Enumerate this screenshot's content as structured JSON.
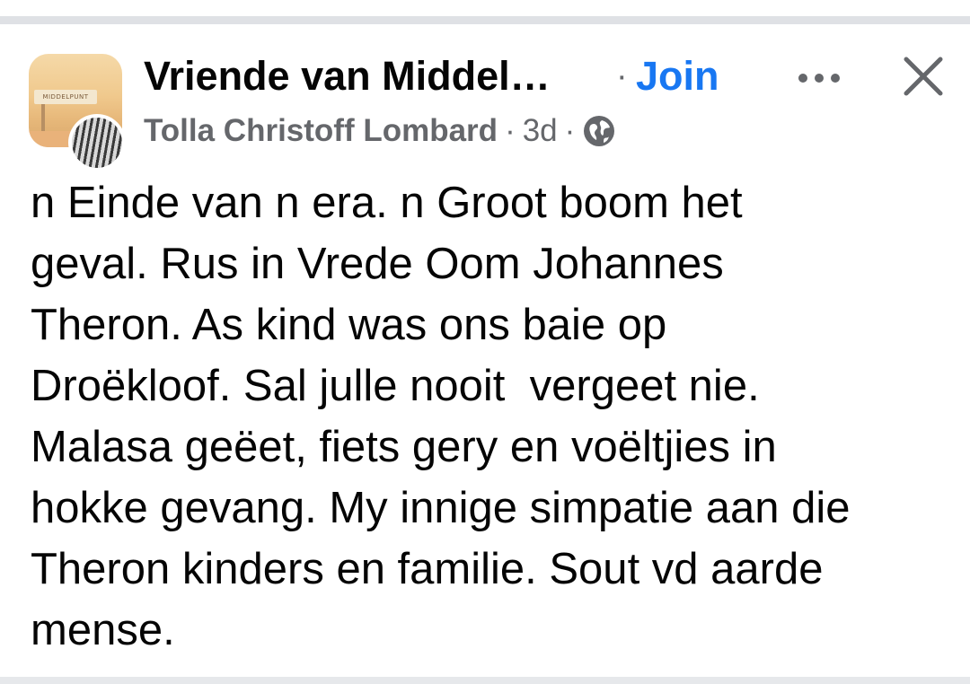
{
  "header": {
    "group_name": "Vriende van Middel…",
    "dot_separator": "·",
    "join_label": "Join",
    "author": "Tolla Christoff Lombard",
    "meta_sep_1": "·",
    "timestamp": "3d",
    "meta_sep_2": "·",
    "privacy_icon": "globe-icon",
    "more_icon": "more-horizontal-icon",
    "close_icon": "close-icon",
    "group_avatar_sign_text": "MIDDELPUNT"
  },
  "post": {
    "lines": [
      "n Einde van n era. n Groot boom het",
      "geval. Rus in Vrede Oom Johannes",
      "Theron. As kind was ons baie op",
      "Droëkloof. Sal julle nooit  vergeet nie.",
      "Malasa geëet, fiets gery en voëltjies in",
      "hokke gevang. My innige simpatie aan die",
      "Theron kinders en familie. Sout vd aarde",
      "mense."
    ]
  },
  "colors": {
    "join": "#1877f2",
    "meta": "#65676b",
    "text": "#050505",
    "divider": "#dfe1e5"
  }
}
